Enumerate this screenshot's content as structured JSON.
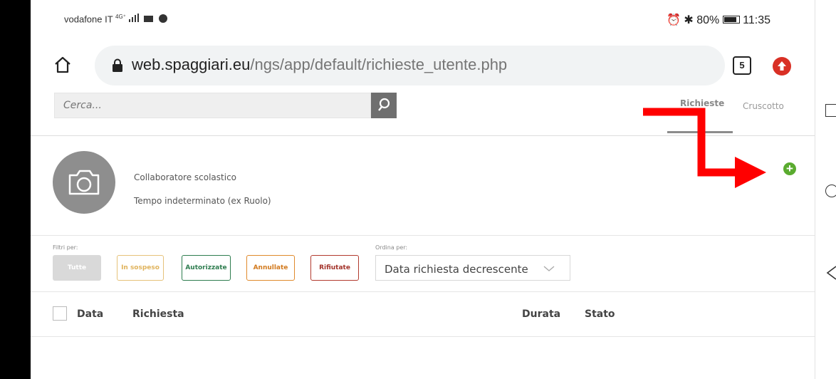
{
  "status_bar": {
    "carrier": "vodafone IT",
    "signal": "4G⁺",
    "battery": "80%",
    "time": "11:35"
  },
  "browser": {
    "url_domain": "web.spaggiari.eu",
    "url_path": "/ngs/app/default/richieste_utente.php",
    "tab_count": "5"
  },
  "search": {
    "placeholder": "Cerca..."
  },
  "tabs": {
    "richieste": "Richieste",
    "cruscotto": "Cruscotto"
  },
  "profile": {
    "role": "Collaboratore scolastico",
    "contract": "Tempo indeterminato (ex Ruolo)"
  },
  "filters": {
    "label": "Filtri per:",
    "buttons": [
      "Tutte",
      "In sospeso",
      "Autorizzate",
      "Annullate",
      "Rifiutate"
    ]
  },
  "order": {
    "label": "Ordina per:",
    "selected": "Data richiesta decrescente"
  },
  "table": {
    "columns": [
      "Data",
      "Richiesta",
      "Durata",
      "Stato"
    ]
  },
  "colors": {
    "accent_green": "#5aab2f",
    "annotation_arrow": "#ff0000"
  },
  "icons": [
    "home-icon",
    "lock-icon",
    "search-icon",
    "camera-icon",
    "add-icon",
    "chevron-down-icon",
    "tabs-icon",
    "extension-icon",
    "alarm-icon",
    "bluetooth-icon",
    "battery-icon"
  ]
}
